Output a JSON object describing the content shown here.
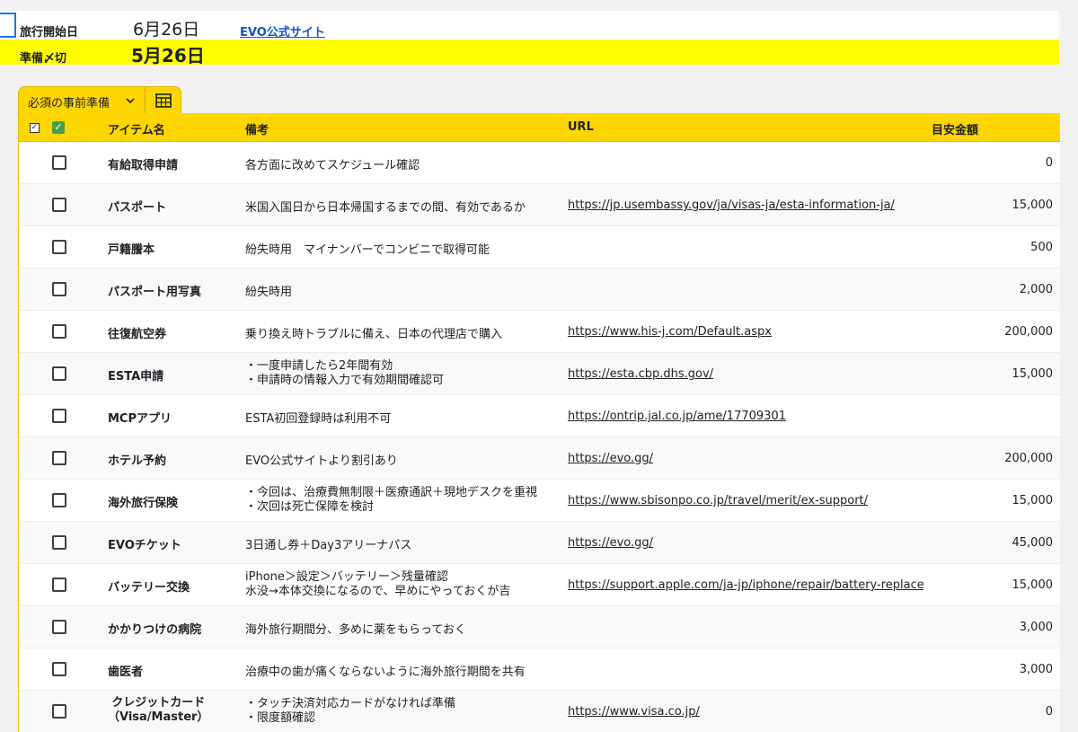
{
  "header": {
    "start_label": "旅行開始日",
    "start_date": "6月26日",
    "evo_link": "EVO公式サイト",
    "deadline_label": "準備〆切",
    "deadline_date": "5月26日"
  },
  "tab": {
    "label": "必須の事前準備"
  },
  "table": {
    "headers": {
      "item": "アイテム名",
      "note": "備考",
      "url": "URL",
      "amount": "目安金額"
    },
    "rows": [
      {
        "name": [
          "有給取得申請"
        ],
        "note": [
          "各方面に改めてスケジュール確認"
        ],
        "url": "",
        "amount": "0"
      },
      {
        "name": [
          "パスポート"
        ],
        "note": [
          "米国入国日から日本帰国するまでの間、有効であるか"
        ],
        "url": "https://jp.usembassy.gov/ja/visas-ja/esta-information-ja/",
        "amount": "15,000"
      },
      {
        "name": [
          "戸籍謄本"
        ],
        "note": [
          "紛失時用　マイナンバーでコンビニで取得可能"
        ],
        "url": "",
        "amount": "500"
      },
      {
        "name": [
          "パスポート用写真"
        ],
        "note": [
          "紛失時用"
        ],
        "url": "",
        "amount": "2,000"
      },
      {
        "name": [
          "往復航空券"
        ],
        "note": [
          "乗り換え時トラブルに備え、日本の代理店で購入"
        ],
        "url": "https://www.his-j.com/Default.aspx",
        "amount": "200,000"
      },
      {
        "name": [
          "ESTA申請"
        ],
        "note": [
          "・一度申請したら2年間有効",
          "・申請時の情報入力で有効期間確認可"
        ],
        "url": "https://esta.cbp.dhs.gov/",
        "amount": "15,000"
      },
      {
        "name": [
          "MCPアプリ"
        ],
        "note": [
          "ESTA初回登録時は利用不可"
        ],
        "url": "https://ontrip.jal.co.jp/ame/17709301",
        "amount": ""
      },
      {
        "name": [
          "ホテル予約"
        ],
        "note": [
          "EVO公式サイトより割引あり"
        ],
        "url": "https://evo.gg/",
        "amount": "200,000"
      },
      {
        "name": [
          "海外旅行保険"
        ],
        "note": [
          "・今回は、治療費無制限＋医療通訳＋現地デスクを重視",
          "・次回は死亡保障を検討"
        ],
        "url": "https://www.sbisonpo.co.jp/travel/merit/ex-support/",
        "amount": "15,000"
      },
      {
        "name": [
          "EVOチケット"
        ],
        "note": [
          "3日通し券＋Day3アリーナパス"
        ],
        "url": "https://evo.gg/",
        "amount": "45,000"
      },
      {
        "name": [
          "バッテリー交換"
        ],
        "note": [
          "iPhone＞設定＞バッテリー＞残量確認",
          "水没→本体交換になるので、早めにやっておくが吉"
        ],
        "url": "https://support.apple.com/ja-jp/iphone/repair/battery-replacement",
        "amount": "15,000"
      },
      {
        "name": [
          "かかりつけの病院"
        ],
        "note": [
          "海外旅行期間分、多めに薬をもらっておく"
        ],
        "url": "",
        "amount": "3,000"
      },
      {
        "name": [
          "歯医者"
        ],
        "note": [
          "治療中の歯が痛くならないように海外旅行期間を共有"
        ],
        "url": "",
        "amount": "3,000"
      },
      {
        "name": [
          "クレジットカード",
          "（Visa/Master）"
        ],
        "note": [
          "・タッチ決済対応カードがなければ準備",
          "・限度額確認"
        ],
        "url": "https://www.visa.co.jp/",
        "amount": "0"
      }
    ]
  }
}
